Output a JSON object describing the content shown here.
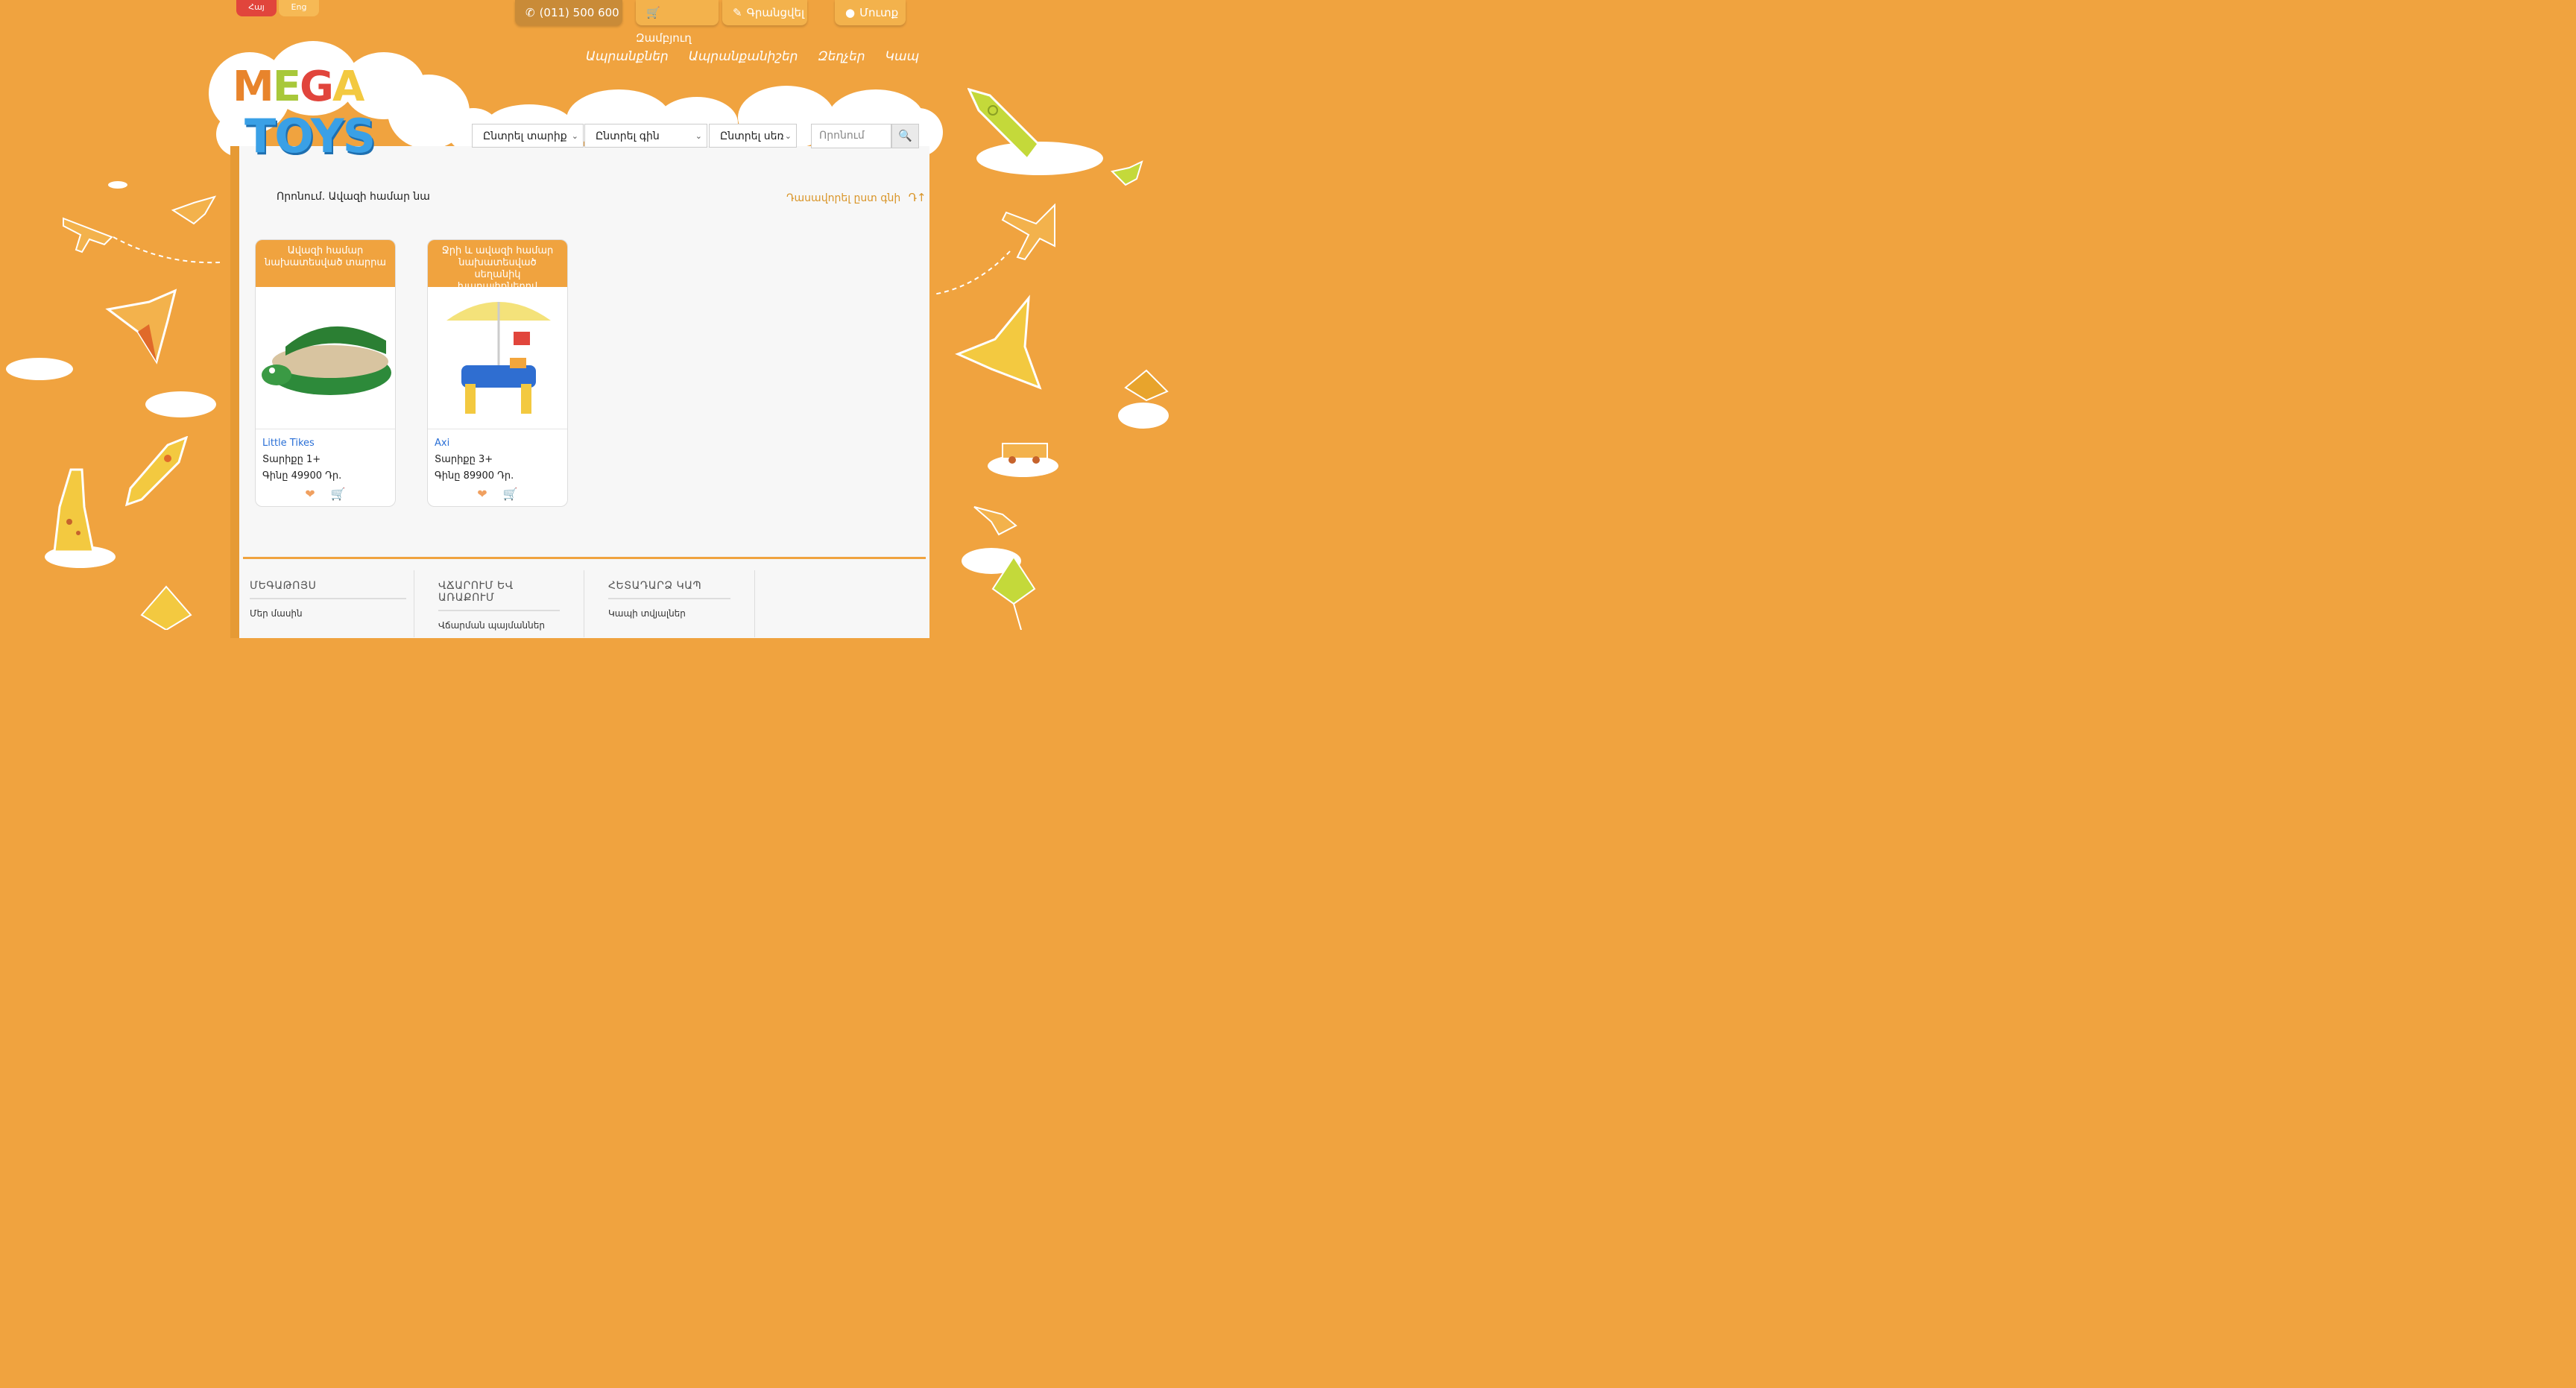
{
  "lang": {
    "hy": "Հայ",
    "en": "Eng"
  },
  "top": {
    "phone": "(011) 500 600",
    "cart": "Զամբյուղ",
    "register": "Գրանցվել",
    "login": "Մուտք"
  },
  "nav": [
    "Ապրանքներ",
    "Ապրանքանիշեր",
    "Զեղչեր",
    "Կապ"
  ],
  "logo": {
    "line1": "MEGA",
    "line2": "TOYS"
  },
  "filters": {
    "age": "Ընտրել տարիք",
    "price": "Ընտրել գին",
    "gender": "Ընտրել սեռ",
    "search_placeholder": "Որոնում"
  },
  "results": {
    "label": "Որոնում. Ավազի համար նա",
    "sort": "Դասավորել ըստ գնի"
  },
  "products": [
    {
      "title": "Ավազի համար նախատեսված տարրա",
      "brand": "Little Tikes",
      "age": "Տարիքը 1+",
      "price": "Գինը 49900 Դր."
    },
    {
      "title": "Ջրի և ավազի համար նախատեսված սեղանիկ խաղալիքներով",
      "brand": "Axi",
      "age": "Տարիքը 3+",
      "price": "Գինը 89900 Դր."
    }
  ],
  "footer": {
    "col1": {
      "title": "ՄԵԳԱԹՈՅՍ",
      "items": [
        "Մեր մասին"
      ]
    },
    "col2": {
      "title": "ՎՃԱՐՈՒՄ ԵՎ ԱՌԱՔՈՒՄ",
      "items": [
        "Վճարման պայմաններ"
      ]
    },
    "col3": {
      "title": "ՀԵՏԱԴԱՐՁ ԿԱՊ",
      "items": [
        "Կապի տվյալներ"
      ]
    }
  },
  "colors": {
    "background": "#f0a33f",
    "accent_red": "#e1453c",
    "link_blue": "#2a6fd6"
  }
}
